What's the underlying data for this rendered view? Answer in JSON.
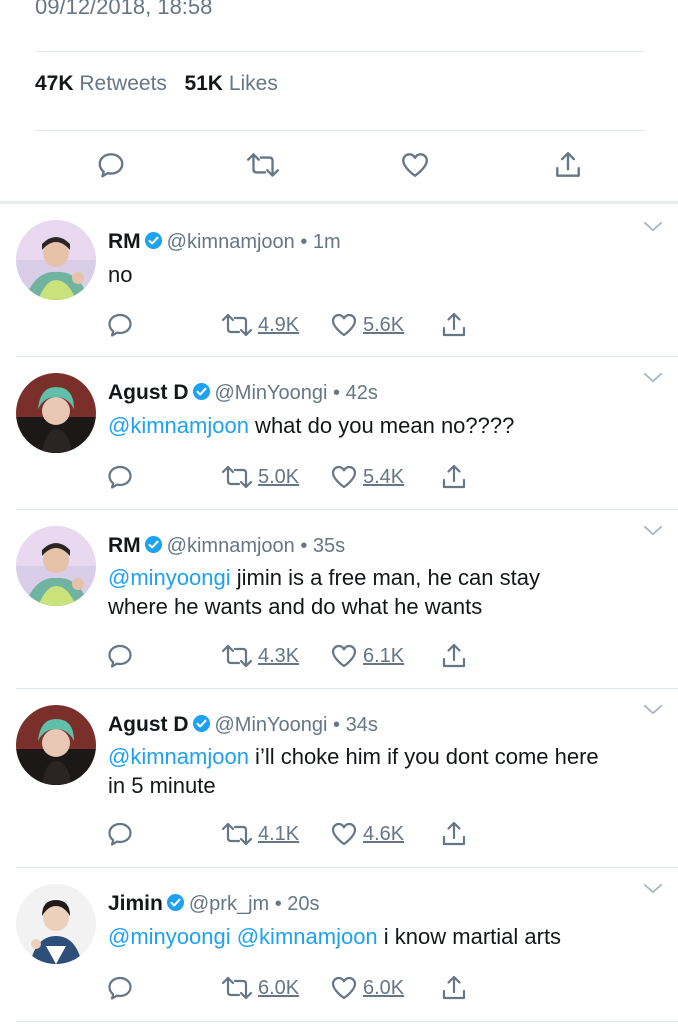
{
  "timestamp": "09/12/2018, 18:58",
  "stats": {
    "retweets_count": "47K",
    "retweets_label": "Retweets",
    "likes_count": "51K",
    "likes_label": "Likes"
  },
  "colors": {
    "link": "#1da1f2",
    "muted": "#657786",
    "verified": "#1da1f2"
  },
  "tweets": [
    {
      "name": "RM",
      "handle": "@kimnamjoon",
      "time": "• 1m",
      "text_mention": "",
      "text_rest": "no",
      "retweets": "4.9K",
      "likes": "5.6K"
    },
    {
      "name": "Agust D",
      "handle": "@MinYoongi",
      "time": "• 42s",
      "text_mention": "@kimnamjoon",
      "text_rest": " what do you mean no????",
      "retweets": "5.0K",
      "likes": "5.4K"
    },
    {
      "name": "RM",
      "handle": "@kimnamjoon",
      "time": "• 35s",
      "text_mention": "@minyoongi",
      "text_rest": " jimin is a free man, he can stay where he wants and do what he wants",
      "retweets": "4.3K",
      "likes": "6.1K"
    },
    {
      "name": "Agust D",
      "handle": "@MinYoongi",
      "time": "• 34s",
      "text_mention": "@kimnamjoon",
      "text_rest": " i’ll choke him if you dont come here in 5 minute",
      "retweets": "4.1K",
      "likes": "4.6K"
    },
    {
      "name": "Jimin",
      "handle": "@prk_jm",
      "time": "• 20s",
      "text_mention": "@minyoongi @kimnamjoon",
      "text_rest": " i know martial arts",
      "retweets": "6.0K",
      "likes": "6.0K"
    }
  ]
}
